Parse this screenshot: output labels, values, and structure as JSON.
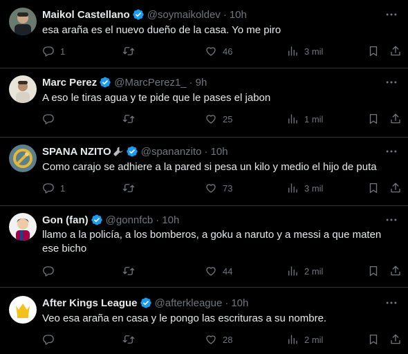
{
  "tweets": [
    {
      "name": "Maikol Castellano",
      "handle": "@soymaikoldev",
      "time": "10h",
      "verified": true,
      "text": "esa araña es el nuevo dueño de la casa. Yo me piro",
      "replies": "1",
      "retweets": "",
      "likes": "46",
      "views": "3 mil"
    },
    {
      "name": "Marc Perez",
      "handle": "@MarcPerez1_",
      "time": "9h",
      "verified": true,
      "text": "A eso le tiras agua y te pide que le pases el jabon",
      "replies": "",
      "retweets": "",
      "likes": "25",
      "views": "1 mil"
    },
    {
      "name": "SPANA NZITO",
      "handle": "@spananzito",
      "time": "10h",
      "verified": true,
      "text": "Como carajo se adhiere a la pared si pesa un kilo y medio el hijo de puta",
      "replies": "1",
      "retweets": "",
      "likes": "73",
      "views": "3 mil"
    },
    {
      "name": "Gon (fan)",
      "handle": "@gonnfcb",
      "time": "10h",
      "verified": true,
      "text": "llamo a la policía, a los bomberos, a goku a naruto y a messi a que maten ese bicho",
      "replies": "",
      "retweets": "",
      "likes": "44",
      "views": "2 mil"
    },
    {
      "name": "After Kings League",
      "handle": "@afterkleague",
      "time": "10h",
      "verified": true,
      "text": "Veo esa araña en casa y le pongo las escrituras a su nombre.",
      "replies": "",
      "retweets": "",
      "likes": "28",
      "views": "2 mil"
    }
  ],
  "colors": {
    "background": "#000000",
    "text": "#e7e9ea",
    "muted": "#71767b",
    "verified": "#1d9bf0",
    "divider": "#2f3336"
  },
  "icons": [
    "verified-badge-icon",
    "more-icon",
    "reply-icon",
    "retweet-icon",
    "like-icon",
    "views-icon",
    "bookmark-icon",
    "share-icon",
    "wrench-icon"
  ]
}
